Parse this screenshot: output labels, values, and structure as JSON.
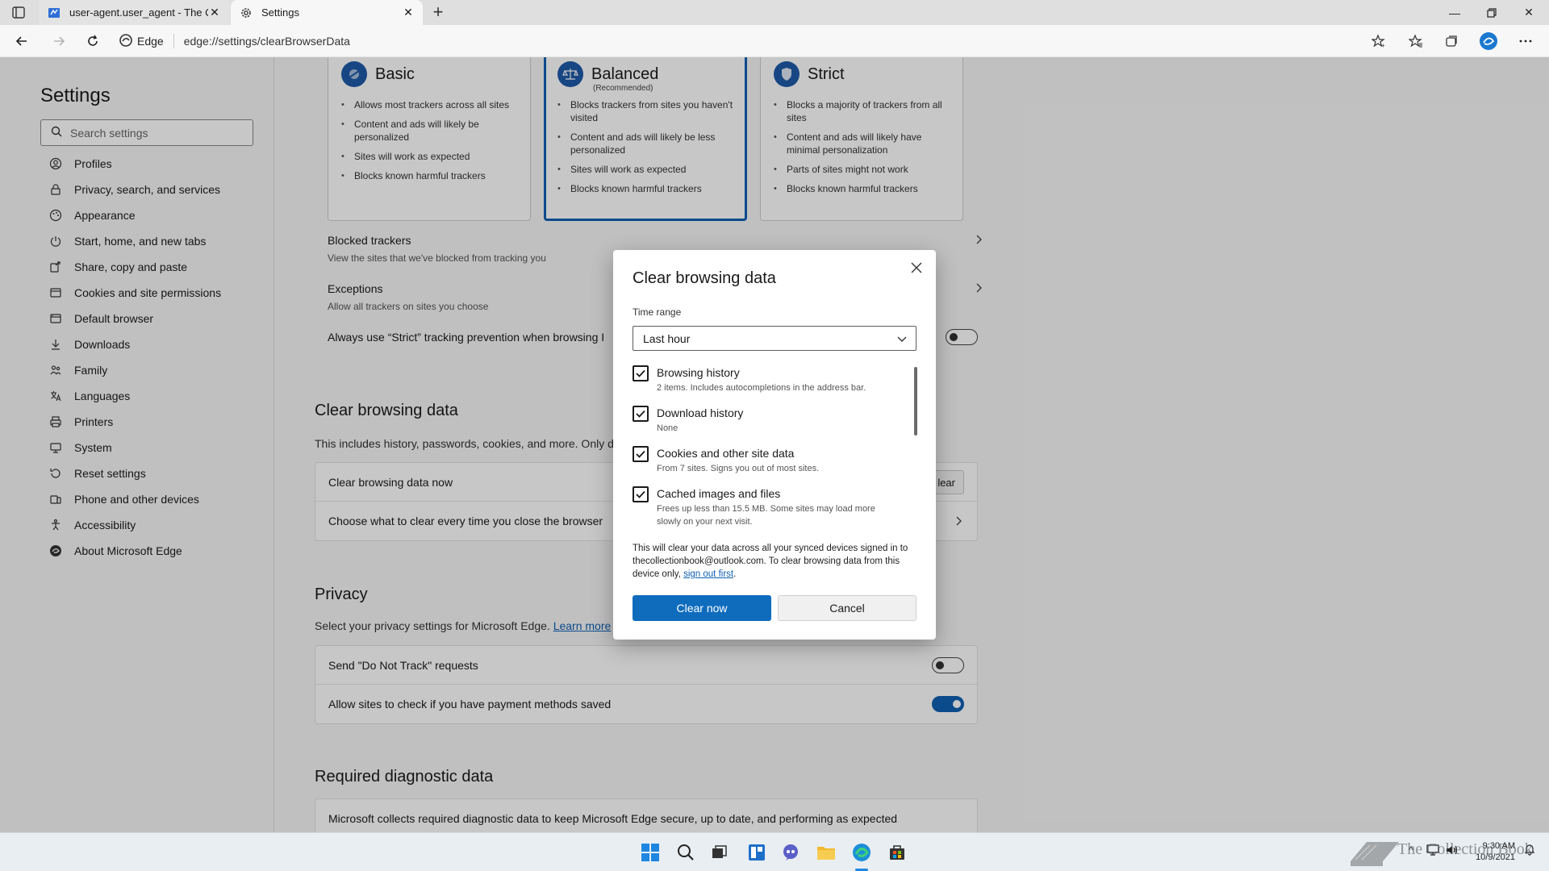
{
  "browser": {
    "tabs": [
      {
        "title": "user-agent.user_agent - The Coll"
      },
      {
        "title": "Settings"
      }
    ],
    "site_label": "Edge",
    "url": "edge://settings/clearBrowserData"
  },
  "sidebar": {
    "title": "Settings",
    "search_placeholder": "Search settings",
    "items": [
      {
        "label": "Profiles",
        "icon": "profile-icon"
      },
      {
        "label": "Privacy, search, and services",
        "icon": "lock-icon"
      },
      {
        "label": "Appearance",
        "icon": "appearance-icon"
      },
      {
        "label": "Start, home, and new tabs",
        "icon": "power-icon"
      },
      {
        "label": "Share, copy and paste",
        "icon": "share-icon"
      },
      {
        "label": "Cookies and site permissions",
        "icon": "cookie-icon"
      },
      {
        "label": "Default browser",
        "icon": "browser-icon"
      },
      {
        "label": "Downloads",
        "icon": "download-icon"
      },
      {
        "label": "Family",
        "icon": "family-icon"
      },
      {
        "label": "Languages",
        "icon": "language-icon"
      },
      {
        "label": "Printers",
        "icon": "printer-icon"
      },
      {
        "label": "System",
        "icon": "system-icon"
      },
      {
        "label": "Reset settings",
        "icon": "reset-icon"
      },
      {
        "label": "Phone and other devices",
        "icon": "phone-icon"
      },
      {
        "label": "Accessibility",
        "icon": "accessibility-icon"
      },
      {
        "label": "About Microsoft Edge",
        "icon": "edge-icon"
      }
    ]
  },
  "tracking": {
    "cards": [
      {
        "title": "Basic",
        "subtitle": "",
        "bullets": [
          "Allows most trackers across all sites",
          "Content and ads will likely be personalized",
          "Sites will work as expected",
          "Blocks known harmful trackers"
        ]
      },
      {
        "title": "Balanced",
        "subtitle": "(Recommended)",
        "bullets": [
          "Blocks trackers from sites you haven't visited",
          "Content and ads will likely be less personalized",
          "Sites will work as expected",
          "Blocks known harmful trackers"
        ]
      },
      {
        "title": "Strict",
        "subtitle": "",
        "bullets": [
          "Blocks a majority of trackers from all sites",
          "Content and ads will likely have minimal personalization",
          "Parts of sites might not work",
          "Blocks known harmful trackers"
        ]
      }
    ],
    "blocked_title": "Blocked trackers",
    "blocked_desc": "View the sites that we've blocked from tracking you",
    "exceptions_title": "Exceptions",
    "exceptions_desc": "Allow all trackers on sites you choose",
    "always_strict": "Always use “Strict” tracking prevention when browsing I"
  },
  "clear_section": {
    "title": "Clear browsing data",
    "desc": "This includes history, passwords, cookies, and more. Only da",
    "row_now": "Clear browsing data now",
    "row_now_btn": "lear",
    "row_close": "Choose what to clear every time you close the browser"
  },
  "privacy": {
    "title": "Privacy",
    "desc": "Select your privacy settings for Microsoft Edge.",
    "learn_more": "Learn more",
    "dnt": "Send \"Do Not Track\" requests",
    "payment": "Allow sites to check if you have payment methods saved",
    "dnt_on": false,
    "payment_on": true
  },
  "diagnostic": {
    "title": "Required diagnostic data",
    "desc": "Microsoft collects required diagnostic data to keep Microsoft Edge secure, up to date, and performing as expected"
  },
  "dialog": {
    "title": "Clear browsing data",
    "time_range_label": "Time range",
    "time_range_value": "Last hour",
    "items": [
      {
        "label": "Browsing history",
        "desc": "2 items. Includes autocompletions in the address bar.",
        "checked": true
      },
      {
        "label": "Download history",
        "desc": "None",
        "checked": true
      },
      {
        "label": "Cookies and other site data",
        "desc": "From 7 sites. Signs you out of most sites.",
        "checked": true
      },
      {
        "label": "Cached images and files",
        "desc": "Frees up less than 15.5 MB. Some sites may load more slowly on your next visit.",
        "checked": true
      }
    ],
    "sync_note": "This will clear your data across all your synced devices signed in to thecollectionbook@outlook.com. To clear browsing data from this device only,",
    "sign_out_link": "sign out first",
    "sync_note_end": ".",
    "clear_btn": "Clear now",
    "cancel_btn": "Cancel"
  },
  "taskbar": {
    "time": "9:30 AM",
    "date": "10/9/2021",
    "watermark": "The Collection Book"
  },
  "colors": {
    "accent": "#0f6cbd",
    "selected_border": "#0f5fb3"
  }
}
